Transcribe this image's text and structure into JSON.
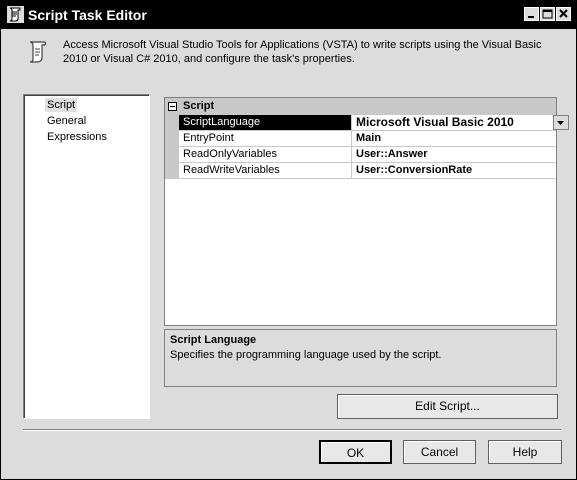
{
  "window": {
    "title": "Script Task Editor",
    "icon": "script-task-icon",
    "controls": [
      "minimize-icon",
      "maximize-icon",
      "close-icon"
    ]
  },
  "header": {
    "description": "Access Microsoft Visual Studio Tools for Applications (VSTA) to write scripts using the Visual Basic 2010 or Visual C# 2010, and configure the task's properties."
  },
  "nav": {
    "items": [
      "Script",
      "General",
      "Expressions"
    ],
    "selected": "Script"
  },
  "properties": {
    "category": "Script",
    "rows": [
      {
        "name": "ScriptLanguage",
        "value": "Microsoft Visual Basic 2010",
        "selected": true
      },
      {
        "name": "EntryPoint",
        "value": "Main"
      },
      {
        "name": "ReadOnlyVariables",
        "value": "User::Answer"
      },
      {
        "name": "ReadWriteVariables",
        "value": "User::ConversionRate"
      }
    ]
  },
  "description_panel": {
    "title": "Script Language",
    "text": "Specifies the programming language used by the script."
  },
  "buttons": {
    "edit_script": "Edit Script...",
    "ok": "OK",
    "cancel": "Cancel",
    "help": "Help"
  }
}
